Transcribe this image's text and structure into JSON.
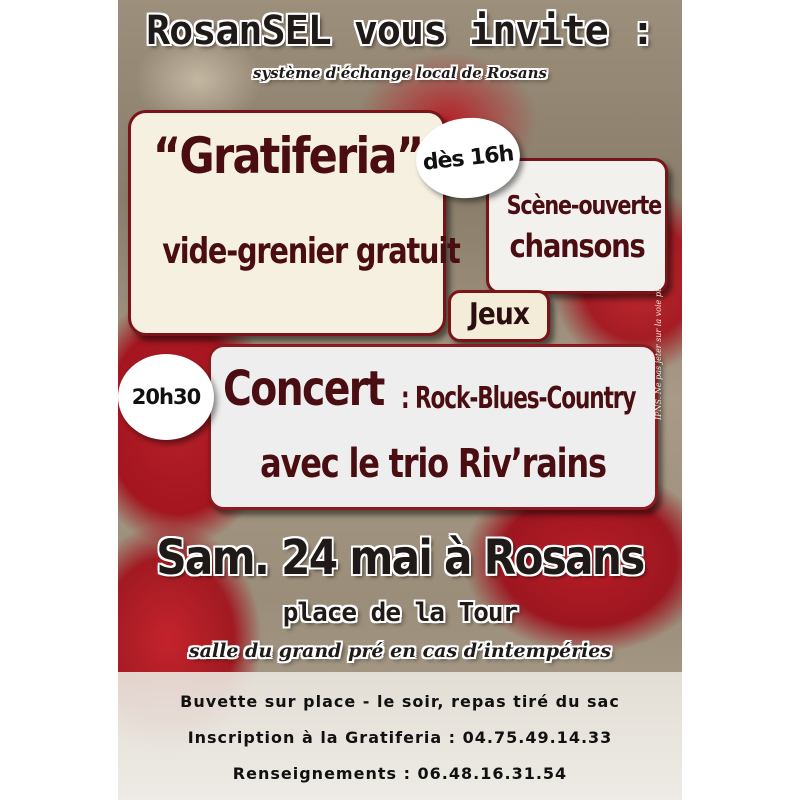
{
  "header": {
    "title": "RosanSEL vous invite :",
    "subtitle": "système d'échange local de Rosans"
  },
  "gratiferia": {
    "name": "“Gratiferia”",
    "description": "vide-grenier gratuit"
  },
  "badges": {
    "start_time": "dès 16h",
    "concert_time": "20h30"
  },
  "scene": {
    "line1": "Scène-ouverte",
    "line2": "chansons"
  },
  "jeux": {
    "label": "Jeux"
  },
  "concert": {
    "word": "Concert",
    "genres": ": Rock-Blues-Country",
    "trio": "avec le trio Riv’rains"
  },
  "side_note": "IPNS. Ne pas jeter sur la voie publique.",
  "event": {
    "date": "Sam. 24 mai à Rosans",
    "place": "place de la Tour",
    "fallback": "salle du grand pré en cas d’intempéries"
  },
  "info": {
    "line1": "Buvette sur place  - le soir, repas tiré du sac",
    "line2": "Inscription à la Gratiferia : 04.75.49.14.33",
    "line3": "Renseignements : 06.48.16.31.54"
  },
  "colors": {
    "accent": "#4a0e12",
    "box_border": "#7a1418",
    "flower_red": "#b8202a"
  }
}
